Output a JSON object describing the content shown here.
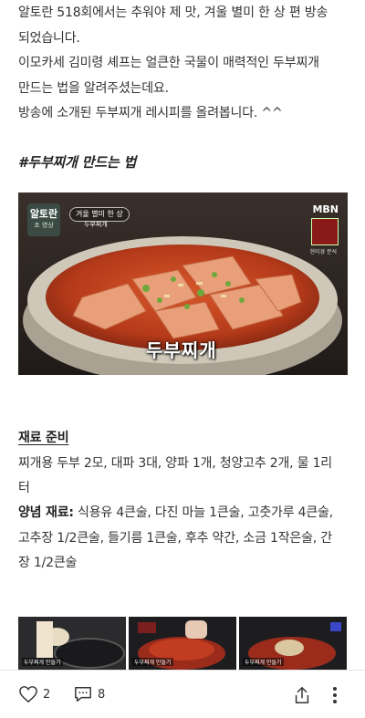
{
  "intro": {
    "line1": "알토란 518회에서는 추워야 제 맛, 겨울 별미 한 상 편 방송",
    "line2": "되었습니다.",
    "line3": "이모카세 김미령 셰프는 얼큰한 국물이 매력적인 두부찌개",
    "line4": "만드는 법을 알려주셨는데요.",
    "line5": "방송에 소개된 두부찌개 레시피를 올려봅니다. ^^"
  },
  "section_heading": "#두부찌개 만드는 법",
  "video": {
    "show_logo": "알토란",
    "show_sub": "조 영상",
    "caption_line1": "겨울 별미 한 상",
    "caption_line2": "두부찌개",
    "channel": "MBN",
    "side_text": "현미경 분석",
    "dish_title": "두부찌개"
  },
  "ingredients": {
    "title": "재료 준비",
    "line1": "찌개용 두부 2모, 대파 3대, 양파 1개, 청양고추 2개, 물 1리",
    "line2": "터"
  },
  "seasoning": {
    "label": "양념 재료:",
    "line1_rest": " 식용유 4큰술, 다진 마늘 1큰술, 고춧가루 4큰술,",
    "line2": "고추장 1/2큰술, 들기름 1큰술, 후추 약간, 소금 1작은술, 간",
    "line3": "장 1/2큰술"
  },
  "thumbnails": [
    {
      "label": "두부찌개 만들기"
    },
    {
      "label": "두부찌개 만들기"
    },
    {
      "label": "두부찌개 만들기"
    }
  ],
  "toolbar": {
    "likes": "2",
    "comments": "8"
  },
  "colors": {
    "text": "#333333",
    "broth_red": "#c2401f",
    "pot_rim": "#cfc8b8"
  }
}
